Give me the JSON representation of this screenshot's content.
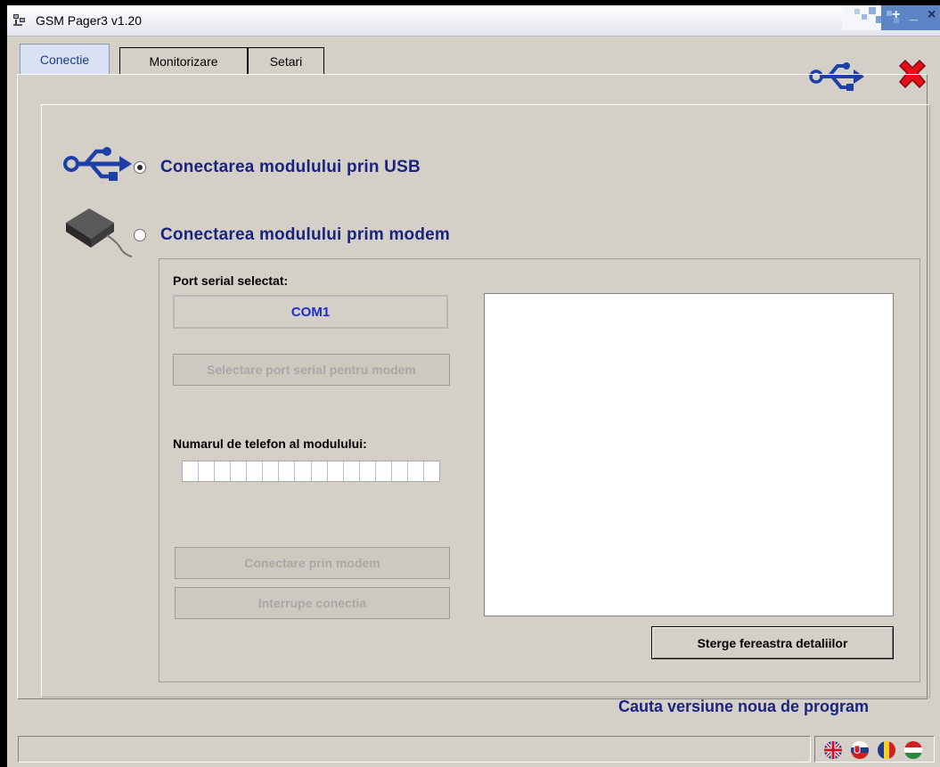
{
  "window": {
    "title": "GSM Pager3  v1.20"
  },
  "tabs": [
    {
      "label": "Conectie",
      "active": true
    },
    {
      "label": "Monitorizare",
      "active": false
    },
    {
      "label": "Setari",
      "active": false
    }
  ],
  "toolbar": {
    "usb_icon": "usb-icon",
    "close_icon": "red-x-icon"
  },
  "connection": {
    "usb_label": "Conectarea modulului prin USB",
    "usb_selected": true,
    "modem_label": "Conectarea modulului prim modem",
    "modem_selected": false
  },
  "modem": {
    "port_label": "Port serial selectat:",
    "port_value": "COM1",
    "select_port_button": "Selectare port serial pentru modem",
    "phone_label": "Numarul de telefon al modulului:",
    "phone_value": "",
    "connect_button": "Conectare prin modem",
    "disconnect_button": "Interrupe conectia"
  },
  "details": {
    "clear_button": "Sterge fereastra detaliilor"
  },
  "update_link": "Cauta versiune noua de program",
  "status": {
    "text": ""
  },
  "languages": [
    "english-flag-icon",
    "slovak-flag-icon",
    "romanian-flag-icon",
    "hungarian-flag-icon"
  ],
  "colors": {
    "accent": "#1a2480",
    "port_text": "#1b2bd1",
    "close_red": "#e0101a"
  }
}
